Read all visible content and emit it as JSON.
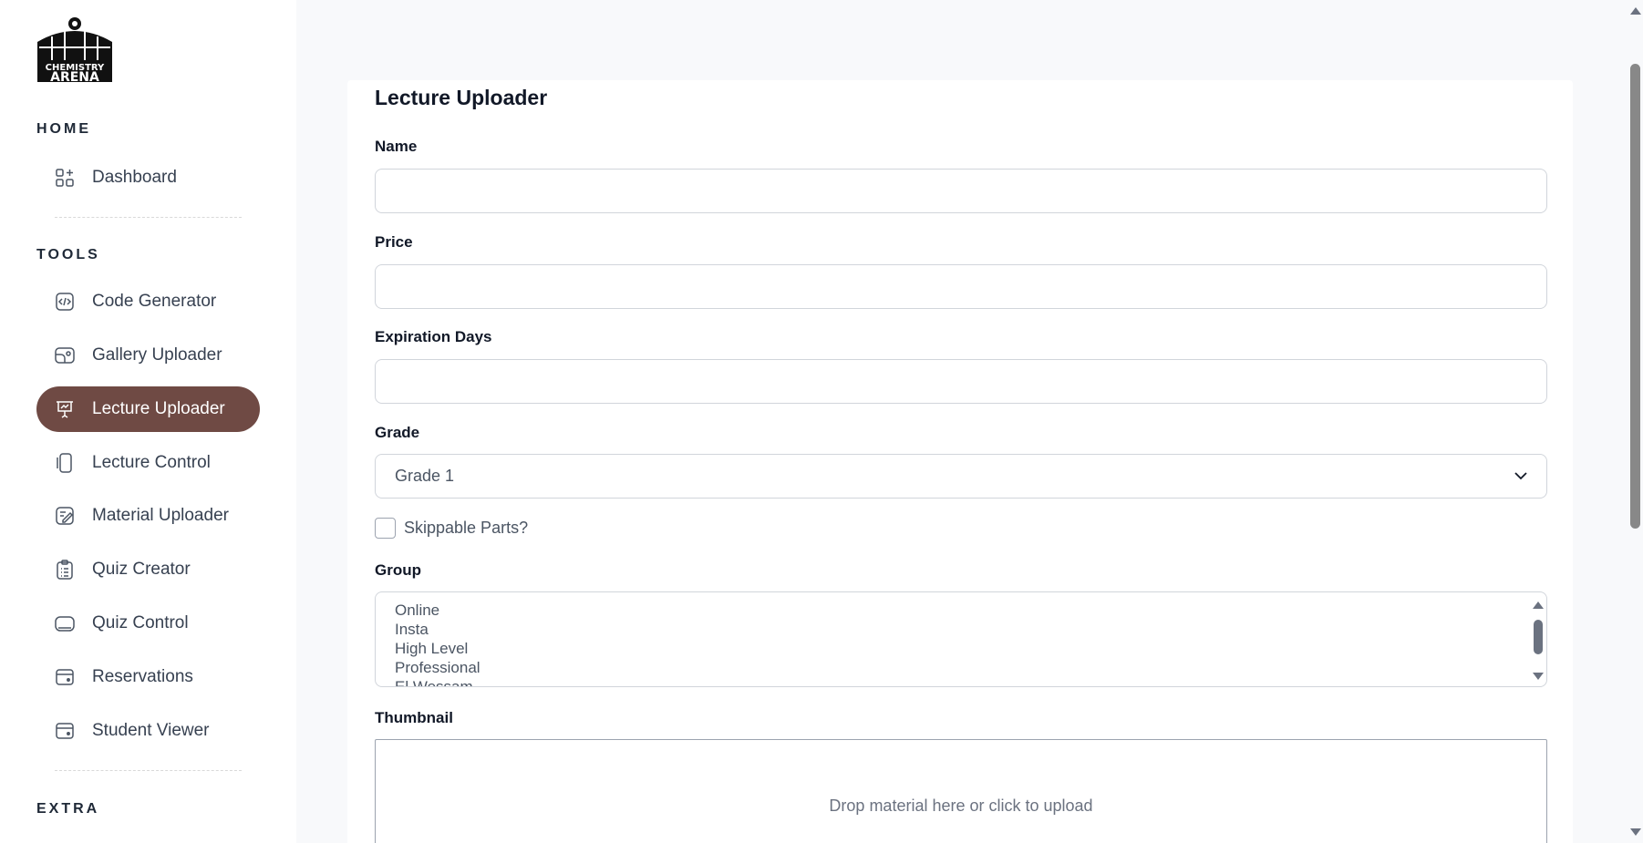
{
  "logo": {
    "line1": "CHEMISTRY",
    "line2": "ARENA"
  },
  "sidebar": {
    "sections": {
      "home": "HOME",
      "tools": "TOOLS",
      "extra": "EXTRA"
    },
    "items": [
      {
        "label": "Dashboard",
        "icon": "dashboard-icon"
      },
      {
        "label": "Code Generator",
        "icon": "code-icon"
      },
      {
        "label": "Gallery Uploader",
        "icon": "gallery-icon"
      },
      {
        "label": "Lecture Uploader",
        "icon": "presentation-icon",
        "active": true
      },
      {
        "label": "Lecture Control",
        "icon": "devices-icon"
      },
      {
        "label": "Material Uploader",
        "icon": "edit-document-icon"
      },
      {
        "label": "Quiz Creator",
        "icon": "clipboard-list-icon"
      },
      {
        "label": "Quiz Control",
        "icon": "tablet-icon"
      },
      {
        "label": "Reservations",
        "icon": "wallet-icon"
      },
      {
        "label": "Student Viewer",
        "icon": "wallet-icon"
      }
    ],
    "active_color": "#6f4a44"
  },
  "form": {
    "title": "Lecture Uploader",
    "name_label": "Name",
    "name_value": "",
    "price_label": "Price",
    "price_value": "",
    "expiration_label": "Expiration Days",
    "expiration_value": "",
    "grade_label": "Grade",
    "grade_value": "Grade 1",
    "skippable_label": "Skippable Parts?",
    "skippable_checked": false,
    "group_label": "Group",
    "group_options": [
      "Online",
      "Insta",
      "High Level",
      "Professional",
      "El Wessam"
    ],
    "thumbnail_label": "Thumbnail",
    "dropzone_text": "Drop material here or click to upload"
  }
}
